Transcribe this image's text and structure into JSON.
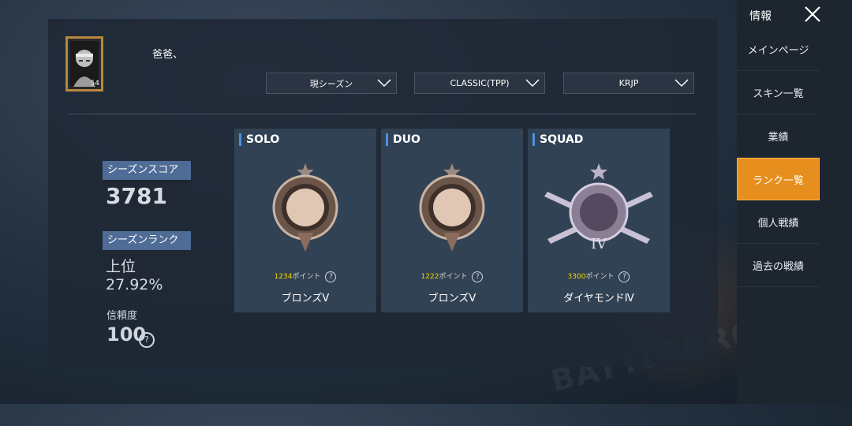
{
  "player": {
    "name": "爸爸、",
    "level": "54"
  },
  "filters": [
    {
      "label": "現シーズン"
    },
    {
      "label": "CLASSIC(TPP)"
    },
    {
      "label": "KRJP"
    }
  ],
  "stats": {
    "season_score_label": "シーズンスコア",
    "season_score_value": "3781",
    "season_rank_label": "シーズンランク",
    "season_rank_value": "上位27.92%",
    "trust_label": "信頼度",
    "trust_value": "100"
  },
  "cards": [
    {
      "tag": "SOLO",
      "points": "1234",
      "points_unit": "ポイント",
      "rank": "ブロンズⅤ"
    },
    {
      "tag": "DUO",
      "points": "1222",
      "points_unit": "ポイント",
      "rank": "ブロンズⅤ"
    },
    {
      "tag": "SQUAD",
      "points": "3300",
      "points_unit": "ポイント",
      "rank": "ダイヤモンドⅣ"
    }
  ],
  "sidebar": {
    "title": "情報",
    "items": [
      {
        "label": "メインページ"
      },
      {
        "label": "スキン一覧"
      },
      {
        "label": "業績"
      },
      {
        "label": "ランク一覧",
        "active": true
      },
      {
        "label": "個人戦績"
      },
      {
        "label": "過去の戦績"
      }
    ]
  },
  "icons": {
    "bronze_badge": "bronze-rank-icon",
    "diamond_badge": "diamond-rank-icon",
    "help": "help-icon",
    "close": "close-icon",
    "chevron": "chevron-down-icon"
  },
  "colors": {
    "accent": "#e68f1e",
    "points_highlight": "#f2d200",
    "label_bg": "#4e6c95"
  }
}
